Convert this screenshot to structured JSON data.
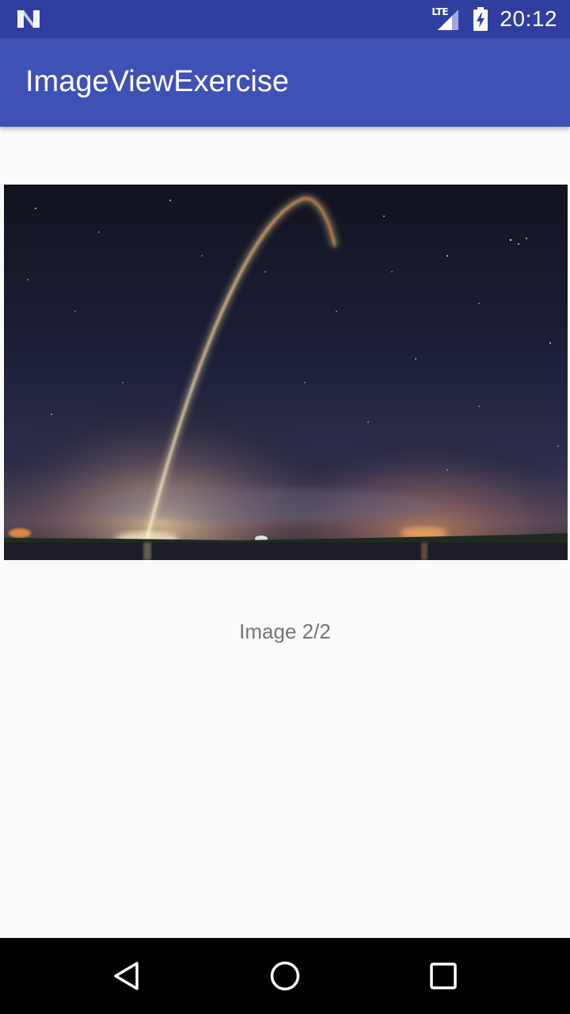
{
  "status_bar": {
    "network_type": "LTE",
    "time": "20:12",
    "icons": {
      "notification": "android-n-icon",
      "signal": "cell-signal-icon",
      "battery": "battery-charging-icon"
    },
    "color": "#303f9f"
  },
  "app_bar": {
    "title": "ImageViewExercise",
    "color": "#3f51b5"
  },
  "content": {
    "image_icon": "rocket-launch-night-photo",
    "caption": "Image 2/2"
  },
  "nav_bar": {
    "icons": {
      "back": "back-triangle-icon",
      "home": "home-circle-icon",
      "recents": "recents-square-icon"
    }
  }
}
